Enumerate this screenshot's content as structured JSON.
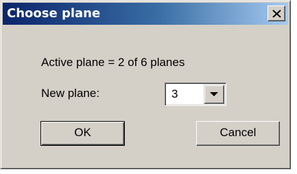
{
  "window": {
    "title": "Choose plane",
    "close_icon": "close-icon"
  },
  "content": {
    "active_plane_text": "Active plane = 2 of  6 planes",
    "new_plane_label": "New plane:",
    "new_plane_select": {
      "selected": "3",
      "arrow_icon": "chevron-down-icon"
    }
  },
  "buttons": {
    "ok_label": "OK",
    "cancel_label": "Cancel"
  },
  "colors": {
    "face": "#d4d0c8",
    "title_active": "#0a246a",
    "title_gradient_end": "#a6caf0"
  }
}
